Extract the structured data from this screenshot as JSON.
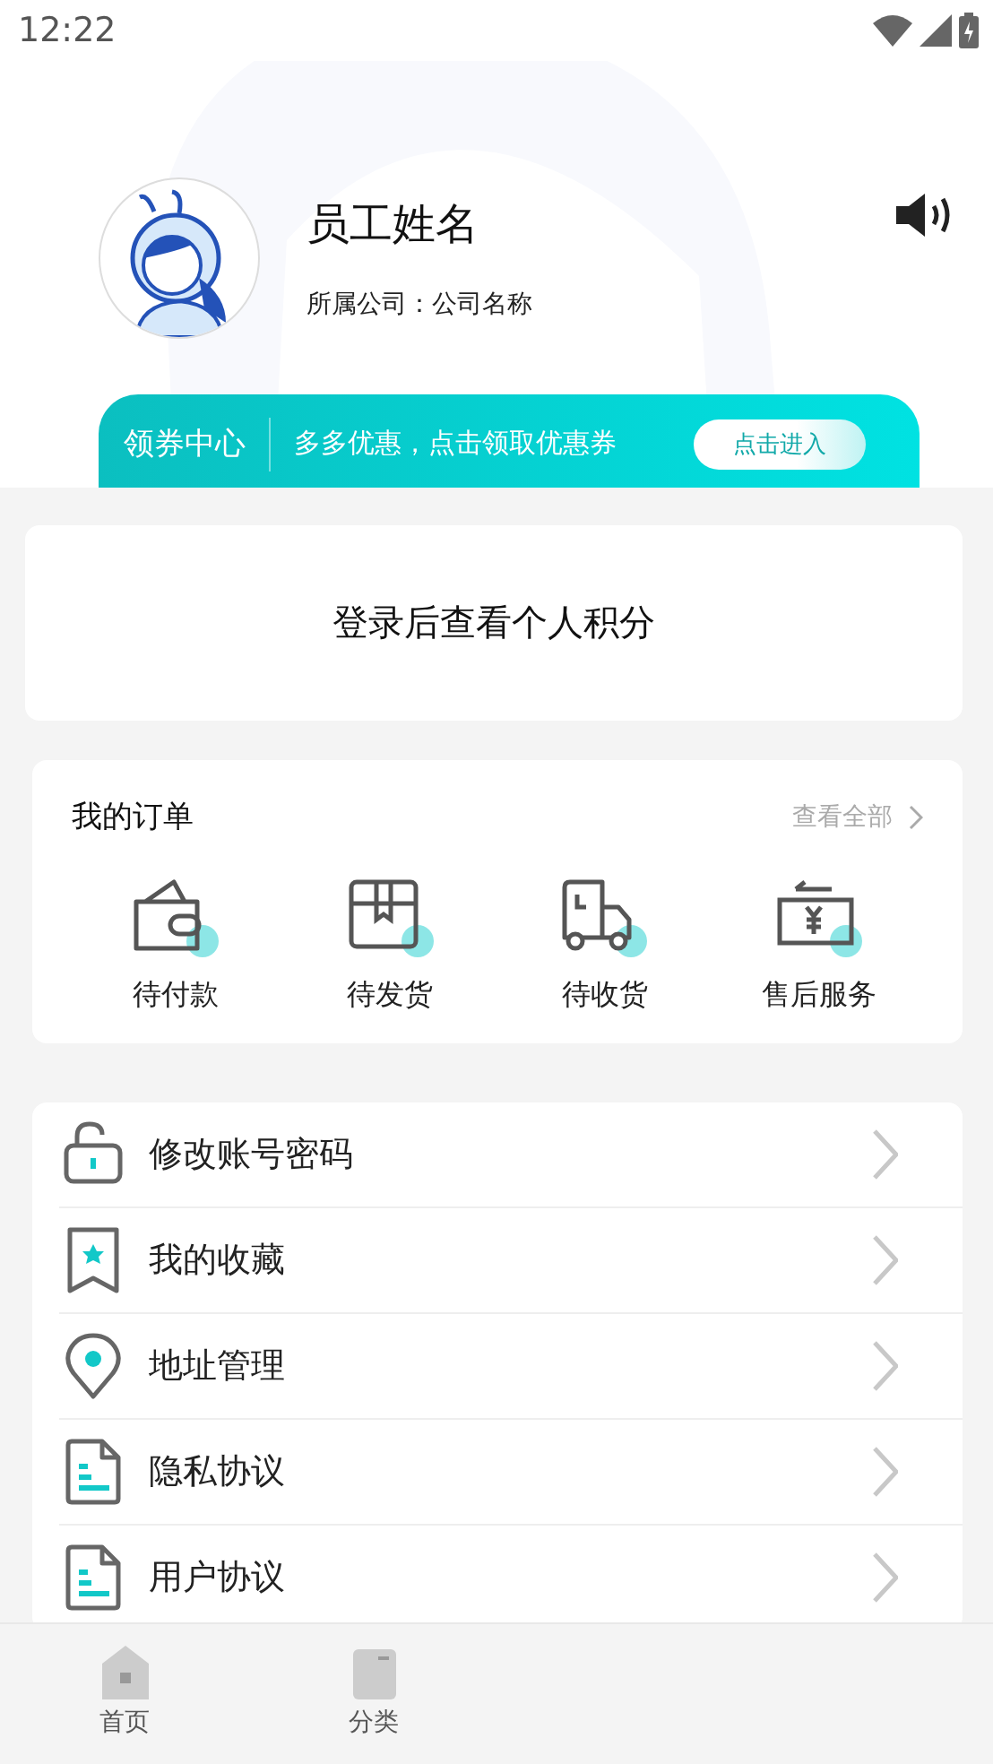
{
  "status_bar": {
    "time": "12:22"
  },
  "profile": {
    "name": "员工姓名",
    "company": "所属公司：公司名称"
  },
  "coupon_banner": {
    "title": "领券中心",
    "text": "多多优惠，点击领取优惠券",
    "button": "点击进入"
  },
  "points_card": {
    "text": "登录后查看个人积分"
  },
  "orders": {
    "title": "我的订单",
    "view_all": "查看全部",
    "items": [
      {
        "label": "待付款"
      },
      {
        "label": "待发货"
      },
      {
        "label": "待收货"
      },
      {
        "label": "售后服务"
      }
    ]
  },
  "menu": [
    {
      "label": "修改账号密码"
    },
    {
      "label": "我的收藏"
    },
    {
      "label": "地址管理"
    },
    {
      "label": "隐私协议"
    },
    {
      "label": "用户协议"
    }
  ],
  "tab_bar": [
    {
      "label": "首页",
      "selected": false
    },
    {
      "label": "分类",
      "selected": false
    }
  ]
}
